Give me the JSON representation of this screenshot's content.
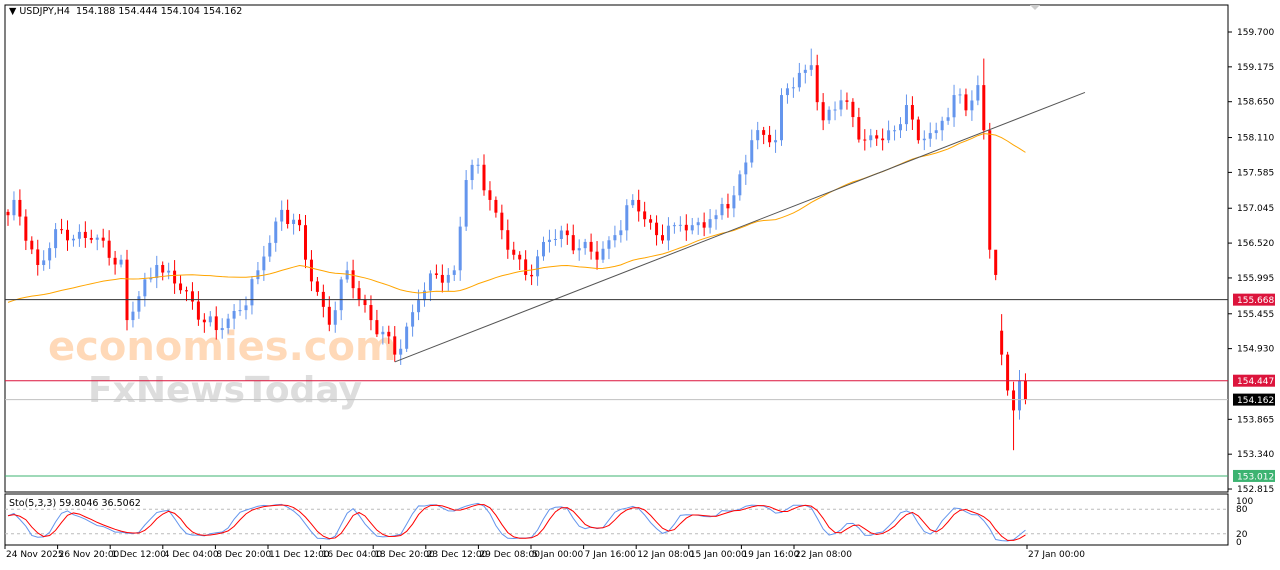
{
  "header": {
    "symbol": "USDJPY,H4",
    "open": "154.188",
    "high": "154.444",
    "low": "154.104",
    "close": "154.162"
  },
  "watermark": {
    "line1": "economies.com",
    "line2": "FxNewsToday"
  },
  "stochastic": {
    "label": "Sto(5,3,3)",
    "main": "59.8046",
    "signal": "36.5062",
    "levels": [
      "100",
      "80",
      "20",
      "0"
    ]
  },
  "colors": {
    "bull": "#6495ED",
    "bear": "#FF0000",
    "ma": "#FFA500",
    "trendline": "#555555",
    "stoch_main": "#6495ED",
    "stoch_signal": "#FF0000",
    "level_red": "#DC143C",
    "level_green": "#3CB371",
    "level_current": "#000000"
  },
  "chart_data": {
    "type": "candlestick",
    "symbol": "USDJPY",
    "timeframe": "H4",
    "ylim": [
      152.7,
      159.95
    ],
    "y_ticks": [
      "159.700",
      "159.175",
      "158.650",
      "158.110",
      "157.585",
      "157.045",
      "156.520",
      "155.995",
      "155.455",
      "154.930",
      "153.865",
      "153.340",
      "152.815"
    ],
    "x_ticks": [
      {
        "label": "24 Nov 2025",
        "bar": 0
      },
      {
        "label": "26 Nov 20:00",
        "bar": 10
      },
      {
        "label": "1 Dec 12:00",
        "bar": 20
      },
      {
        "label": "4 Dec 04:00",
        "bar": 29
      },
      {
        "label": "8 Dec 20:00",
        "bar": 38
      },
      {
        "label": "11 Dec 12:00",
        "bar": 47
      },
      {
        "label": "16 Dec 04:00",
        "bar": 56
      },
      {
        "label": "18 Dec 20:00",
        "bar": 65
      },
      {
        "label": "23 Dec 12:00",
        "bar": 73
      },
      {
        "label": "29 Dec 08:00",
        "bar": 82
      },
      {
        "label": "5 Jan 00:00",
        "bar": 91
      },
      {
        "label": "7 Jan 16:00",
        "bar": 100
      },
      {
        "label": "12 Jan 08:00",
        "bar": 109
      },
      {
        "label": "15 Jan 00:00",
        "bar": 117
      },
      {
        "label": "19 Jan 16:00",
        "bar": 126
      },
      {
        "label": "22 Jan 08:00",
        "bar": 135
      },
      {
        "label": "27 Jan 00:00",
        "bar": 171
      }
    ],
    "close_keypoints": [
      [
        0,
        156.94
      ],
      [
        1,
        157.17
      ],
      [
        5,
        156.19
      ],
      [
        9,
        156.72
      ],
      [
        14,
        156.57
      ],
      [
        19,
        156.27
      ],
      [
        20,
        155.36
      ],
      [
        25,
        156.19
      ],
      [
        29,
        155.81
      ],
      [
        35,
        155.21
      ],
      [
        39,
        155.51
      ],
      [
        42,
        156.11
      ],
      [
        46,
        157.02
      ],
      [
        49,
        156.79
      ],
      [
        50,
        156.27
      ],
      [
        54,
        155.29
      ],
      [
        57,
        156.11
      ],
      [
        61,
        155.36
      ],
      [
        65,
        154.84
      ],
      [
        69,
        155.66
      ],
      [
        72,
        156.04
      ],
      [
        75,
        156.11
      ],
      [
        77,
        157.47
      ],
      [
        79,
        157.7
      ],
      [
        81,
        157.17
      ],
      [
        84,
        156.42
      ],
      [
        87,
        156.04
      ],
      [
        91,
        156.57
      ],
      [
        94,
        156.64
      ],
      [
        99,
        156.27
      ],
      [
        102,
        156.64
      ],
      [
        105,
        157.17
      ],
      [
        109,
        156.64
      ],
      [
        112,
        156.79
      ],
      [
        115,
        156.79
      ],
      [
        119,
        156.94
      ],
      [
        122,
        157.24
      ],
      [
        125,
        158.07
      ],
      [
        127,
        158.15
      ],
      [
        129,
        158.07
      ],
      [
        130,
        158.75
      ],
      [
        134,
        159.13
      ],
      [
        135,
        159.2
      ],
      [
        137,
        158.37
      ],
      [
        140,
        158.67
      ],
      [
        144,
        158.07
      ],
      [
        147,
        158.07
      ],
      [
        149,
        158.22
      ],
      [
        151,
        158.6
      ],
      [
        153,
        158.07
      ],
      [
        156,
        158.22
      ],
      [
        159,
        158.75
      ],
      [
        161,
        158.52
      ],
      [
        163,
        158.9
      ],
      [
        164,
        158.22
      ],
      [
        165,
        156.42
      ],
      [
        166,
        156.04
      ],
      [
        167,
        154.84
      ],
      [
        168,
        154.3
      ],
      [
        169,
        154.0
      ],
      [
        170,
        154.45
      ],
      [
        171,
        154.162
      ]
    ],
    "moving_average_period": 50,
    "trendline": {
      "from": [
        65,
        154.73
      ],
      "to": [
        181,
        158.79
      ]
    },
    "horizontal_levels": [
      {
        "price": "155.668",
        "style": "solid",
        "color": "#DC143C"
      },
      {
        "price": "154.447",
        "style": "solid",
        "color": "#DC143C"
      },
      {
        "price": "154.162",
        "style": "current",
        "color": "#000000"
      },
      {
        "price": "153.012",
        "style": "solid",
        "color": "#3CB371"
      }
    ]
  }
}
